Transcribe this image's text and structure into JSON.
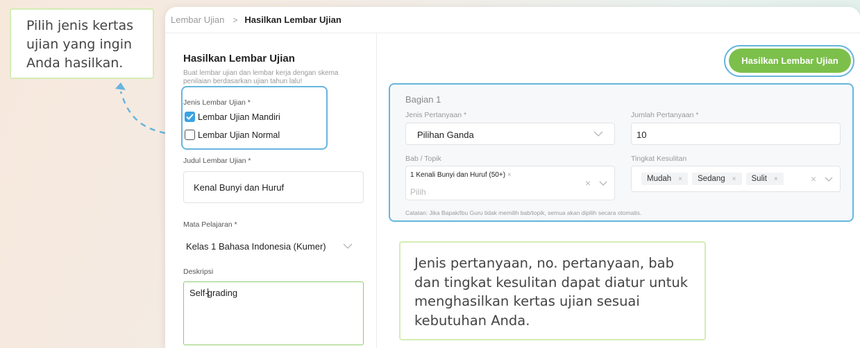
{
  "breadcrumb": {
    "parent": "Lembar Ujian",
    "separator": ">",
    "current": "Hasilkan Lembar Ujian"
  },
  "form": {
    "title": "Hasilkan Lembar Ujian",
    "description": "Buat lembar ujian dan lembar kerja dengan skema penilaian berdasarkan ujian tahun lalu!",
    "type_label": "Jenis Lembar Ujian *",
    "types": [
      {
        "label": "Lembar Ujian Mandiri",
        "checked": true
      },
      {
        "label": "Lembar Ujian Normal",
        "checked": false
      }
    ],
    "title_field_label": "Judul Lembar Ujian *",
    "title_field_value": "Kenal Bunyi dan Huruf",
    "subject_label": "Mata Pelajaran *",
    "subject_value": "Kelas 1 Bahasa Indonesia (Kumer)",
    "desc_label": "Deskripsi",
    "desc_value_before_cursor": "Self-",
    "desc_value_after_cursor": "grading"
  },
  "generate_button": "Hasilkan Lembar Ujian",
  "section": {
    "title": "Bagian 1",
    "question_type_label": "Jenis Pertanyaan *",
    "question_type_value": "Pilihan Ganda",
    "question_count_label": "Jumlah Pertanyaan *",
    "question_count_value": "10",
    "chapter_label": "Bab / Topik",
    "chapter_chip": "1 Kenali Bunyi dan Huruf (50+)",
    "chapter_placeholder": "Pilih",
    "difficulty_label": "Tingkat Kesulitan",
    "difficulties": [
      "Mudah",
      "Sedang",
      "Sulit"
    ],
    "note": "Catatan: Jika Bapak/Ibu Guru tidak memilih bab/topik, semua akan dipilih secara otomatis."
  },
  "tooltips": {
    "left": "Pilih jenis kertas ujian yang ingin Anda hasilkan.",
    "bottom": "Jenis pertanyaan, no. pertanyaan, bab dan tingkat kesulitan dapat diatur untuk menghasilkan kertas ujian sesuai kebutuhan Anda."
  },
  "colors": {
    "accent_green": "#7cc04b",
    "highlight_blue": "#67b5de",
    "check_blue": "#3aa3e3"
  }
}
